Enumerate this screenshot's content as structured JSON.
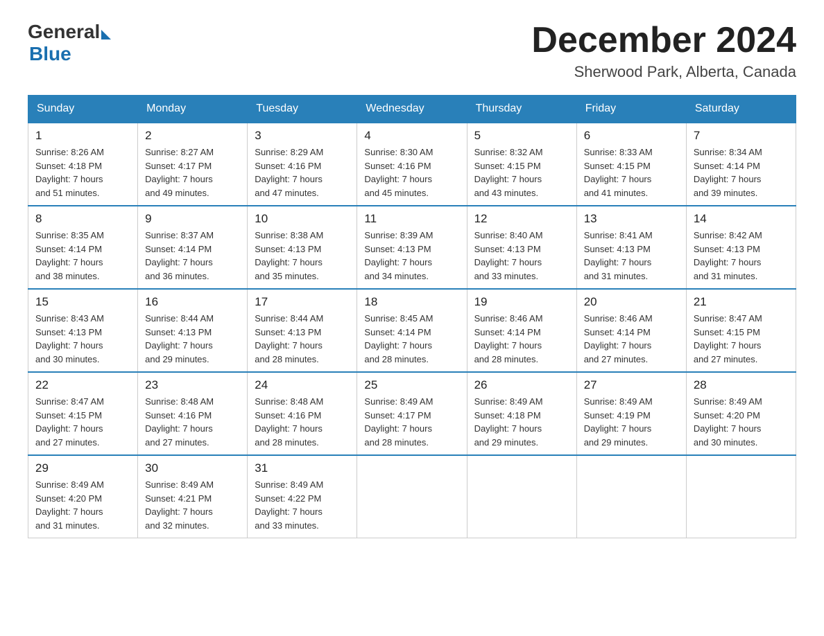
{
  "logo": {
    "general": "General",
    "blue": "Blue"
  },
  "title": "December 2024",
  "subtitle": "Sherwood Park, Alberta, Canada",
  "days_of_week": [
    "Sunday",
    "Monday",
    "Tuesday",
    "Wednesday",
    "Thursday",
    "Friday",
    "Saturday"
  ],
  "weeks": [
    [
      {
        "day": "1",
        "sunrise": "Sunrise: 8:26 AM",
        "sunset": "Sunset: 4:18 PM",
        "daylight": "Daylight: 7 hours",
        "daylight2": "and 51 minutes."
      },
      {
        "day": "2",
        "sunrise": "Sunrise: 8:27 AM",
        "sunset": "Sunset: 4:17 PM",
        "daylight": "Daylight: 7 hours",
        "daylight2": "and 49 minutes."
      },
      {
        "day": "3",
        "sunrise": "Sunrise: 8:29 AM",
        "sunset": "Sunset: 4:16 PM",
        "daylight": "Daylight: 7 hours",
        "daylight2": "and 47 minutes."
      },
      {
        "day": "4",
        "sunrise": "Sunrise: 8:30 AM",
        "sunset": "Sunset: 4:16 PM",
        "daylight": "Daylight: 7 hours",
        "daylight2": "and 45 minutes."
      },
      {
        "day": "5",
        "sunrise": "Sunrise: 8:32 AM",
        "sunset": "Sunset: 4:15 PM",
        "daylight": "Daylight: 7 hours",
        "daylight2": "and 43 minutes."
      },
      {
        "day": "6",
        "sunrise": "Sunrise: 8:33 AM",
        "sunset": "Sunset: 4:15 PM",
        "daylight": "Daylight: 7 hours",
        "daylight2": "and 41 minutes."
      },
      {
        "day": "7",
        "sunrise": "Sunrise: 8:34 AM",
        "sunset": "Sunset: 4:14 PM",
        "daylight": "Daylight: 7 hours",
        "daylight2": "and 39 minutes."
      }
    ],
    [
      {
        "day": "8",
        "sunrise": "Sunrise: 8:35 AM",
        "sunset": "Sunset: 4:14 PM",
        "daylight": "Daylight: 7 hours",
        "daylight2": "and 38 minutes."
      },
      {
        "day": "9",
        "sunrise": "Sunrise: 8:37 AM",
        "sunset": "Sunset: 4:14 PM",
        "daylight": "Daylight: 7 hours",
        "daylight2": "and 36 minutes."
      },
      {
        "day": "10",
        "sunrise": "Sunrise: 8:38 AM",
        "sunset": "Sunset: 4:13 PM",
        "daylight": "Daylight: 7 hours",
        "daylight2": "and 35 minutes."
      },
      {
        "day": "11",
        "sunrise": "Sunrise: 8:39 AM",
        "sunset": "Sunset: 4:13 PM",
        "daylight": "Daylight: 7 hours",
        "daylight2": "and 34 minutes."
      },
      {
        "day": "12",
        "sunrise": "Sunrise: 8:40 AM",
        "sunset": "Sunset: 4:13 PM",
        "daylight": "Daylight: 7 hours",
        "daylight2": "and 33 minutes."
      },
      {
        "day": "13",
        "sunrise": "Sunrise: 8:41 AM",
        "sunset": "Sunset: 4:13 PM",
        "daylight": "Daylight: 7 hours",
        "daylight2": "and 31 minutes."
      },
      {
        "day": "14",
        "sunrise": "Sunrise: 8:42 AM",
        "sunset": "Sunset: 4:13 PM",
        "daylight": "Daylight: 7 hours",
        "daylight2": "and 31 minutes."
      }
    ],
    [
      {
        "day": "15",
        "sunrise": "Sunrise: 8:43 AM",
        "sunset": "Sunset: 4:13 PM",
        "daylight": "Daylight: 7 hours",
        "daylight2": "and 30 minutes."
      },
      {
        "day": "16",
        "sunrise": "Sunrise: 8:44 AM",
        "sunset": "Sunset: 4:13 PM",
        "daylight": "Daylight: 7 hours",
        "daylight2": "and 29 minutes."
      },
      {
        "day": "17",
        "sunrise": "Sunrise: 8:44 AM",
        "sunset": "Sunset: 4:13 PM",
        "daylight": "Daylight: 7 hours",
        "daylight2": "and 28 minutes."
      },
      {
        "day": "18",
        "sunrise": "Sunrise: 8:45 AM",
        "sunset": "Sunset: 4:14 PM",
        "daylight": "Daylight: 7 hours",
        "daylight2": "and 28 minutes."
      },
      {
        "day": "19",
        "sunrise": "Sunrise: 8:46 AM",
        "sunset": "Sunset: 4:14 PM",
        "daylight": "Daylight: 7 hours",
        "daylight2": "and 28 minutes."
      },
      {
        "day": "20",
        "sunrise": "Sunrise: 8:46 AM",
        "sunset": "Sunset: 4:14 PM",
        "daylight": "Daylight: 7 hours",
        "daylight2": "and 27 minutes."
      },
      {
        "day": "21",
        "sunrise": "Sunrise: 8:47 AM",
        "sunset": "Sunset: 4:15 PM",
        "daylight": "Daylight: 7 hours",
        "daylight2": "and 27 minutes."
      }
    ],
    [
      {
        "day": "22",
        "sunrise": "Sunrise: 8:47 AM",
        "sunset": "Sunset: 4:15 PM",
        "daylight": "Daylight: 7 hours",
        "daylight2": "and 27 minutes."
      },
      {
        "day": "23",
        "sunrise": "Sunrise: 8:48 AM",
        "sunset": "Sunset: 4:16 PM",
        "daylight": "Daylight: 7 hours",
        "daylight2": "and 27 minutes."
      },
      {
        "day": "24",
        "sunrise": "Sunrise: 8:48 AM",
        "sunset": "Sunset: 4:16 PM",
        "daylight": "Daylight: 7 hours",
        "daylight2": "and 28 minutes."
      },
      {
        "day": "25",
        "sunrise": "Sunrise: 8:49 AM",
        "sunset": "Sunset: 4:17 PM",
        "daylight": "Daylight: 7 hours",
        "daylight2": "and 28 minutes."
      },
      {
        "day": "26",
        "sunrise": "Sunrise: 8:49 AM",
        "sunset": "Sunset: 4:18 PM",
        "daylight": "Daylight: 7 hours",
        "daylight2": "and 29 minutes."
      },
      {
        "day": "27",
        "sunrise": "Sunrise: 8:49 AM",
        "sunset": "Sunset: 4:19 PM",
        "daylight": "Daylight: 7 hours",
        "daylight2": "and 29 minutes."
      },
      {
        "day": "28",
        "sunrise": "Sunrise: 8:49 AM",
        "sunset": "Sunset: 4:20 PM",
        "daylight": "Daylight: 7 hours",
        "daylight2": "and 30 minutes."
      }
    ],
    [
      {
        "day": "29",
        "sunrise": "Sunrise: 8:49 AM",
        "sunset": "Sunset: 4:20 PM",
        "daylight": "Daylight: 7 hours",
        "daylight2": "and 31 minutes."
      },
      {
        "day": "30",
        "sunrise": "Sunrise: 8:49 AM",
        "sunset": "Sunset: 4:21 PM",
        "daylight": "Daylight: 7 hours",
        "daylight2": "and 32 minutes."
      },
      {
        "day": "31",
        "sunrise": "Sunrise: 8:49 AM",
        "sunset": "Sunset: 4:22 PM",
        "daylight": "Daylight: 7 hours",
        "daylight2": "and 33 minutes."
      },
      null,
      null,
      null,
      null
    ]
  ]
}
